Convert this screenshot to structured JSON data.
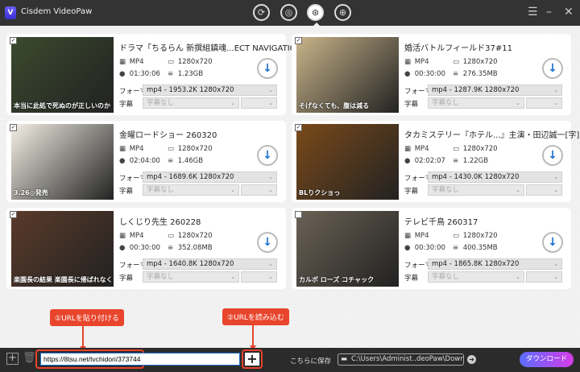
{
  "app": {
    "title": "Cisdem VideoPaw",
    "logo_letter": "V"
  },
  "modes": [
    {
      "name": "convert",
      "glyph": "⟳"
    },
    {
      "name": "dvd-convert",
      "glyph": "◎"
    },
    {
      "name": "download",
      "glyph": "⊛"
    },
    {
      "name": "download-list",
      "glyph": "⊕"
    }
  ],
  "labels": {
    "format": "フォーマッ",
    "subtitle": "字幕"
  },
  "cards": [
    {
      "title": "ドラマ「ちるらん 新撰組鎮魂...ECT NAVIGATION",
      "container": "MP4",
      "resolution": "1280x720",
      "duration": "01:30:06",
      "size": "1.23GB",
      "format": "mp4 - 1953.2K 1280x720",
      "subtitle": "字幕なし",
      "checked": true,
      "caption": "本当に此処で死ぬのが正しいのか",
      "thumb": "#3b4a2e"
    },
    {
      "title": "婚活バトルフィールド37#11",
      "container": "MP4",
      "resolution": "1280x720",
      "duration": "00:30:00",
      "size": "276.35MB",
      "format": "mp4 - 1287.9K 1280x720",
      "subtitle": "字幕なし",
      "checked": true,
      "caption": "そげなくても、腹は減る",
      "thumb": "#c9b48a"
    },
    {
      "title": "金曜ロードショー 260320",
      "container": "MP4",
      "resolution": "1280x720",
      "duration": "02:04:00",
      "size": "1.46GB",
      "format": "mp4 - 1689.6K 1280x720",
      "subtitle": "字幕なし",
      "checked": true,
      "caption": "3.26◎発売",
      "thumb": "#f4f0e6"
    },
    {
      "title": "タカミステリー『ホテル...』主演・田辺誠一[字]",
      "container": "MP4",
      "resolution": "1280x720",
      "duration": "02:02:07",
      "size": "1.22GB",
      "format": "mp4 - 1430.0K 1280x720",
      "subtitle": "字幕なし",
      "checked": true,
      "caption": "BLりクショっ",
      "thumb": "#7a4a1a"
    },
    {
      "title": "しくじり先生 260228",
      "container": "MP4",
      "resolution": "1280x720",
      "duration": "00:30:00",
      "size": "352.08MB",
      "format": "mp4 - 1640.8K 1280x720",
      "subtitle": "字幕なし",
      "checked": true,
      "caption": "楽園長の結果 楽園長に帰ばれなくなる",
      "thumb": "#5a3a2a"
    },
    {
      "title": "テレビ千鳥 260317",
      "container": "MP4",
      "resolution": "1280x720",
      "duration": "00:30:00",
      "size": "400.35MB",
      "format": "mp4 - 1865.8K 1280x720",
      "subtitle": "字幕なし",
      "checked": false,
      "caption": "カルボ ローズ コチャック",
      "thumb": "#6b6255"
    }
  ],
  "annotations": {
    "step1": "①URLを貼り付ける",
    "step2": "②URLを読み込む",
    "color": "#e8452c"
  },
  "bottom": {
    "url_value": "https://8tsu.net/tvchidori/373744",
    "save_label": "こちらに保存",
    "save_path": "C:\\Users\\Administ..deoPaw\\Downloaded",
    "download_all": "ダウンロード"
  }
}
